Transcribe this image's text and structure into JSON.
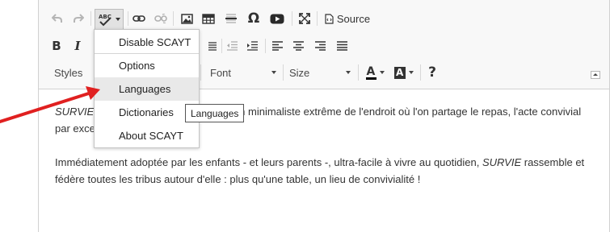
{
  "toolbar": {
    "undo_icon": "undo-icon",
    "redo_icon": "redo-icon",
    "spellcheck_icon": "spellcheck-abc-icon",
    "source_label": "Source",
    "bold_glyph": "B",
    "italic_glyph": "I",
    "omega_glyph": "Ω",
    "help_glyph": "?",
    "text_color_glyph": "A",
    "bg_color_glyph": "A",
    "combos": {
      "styles": "Styles",
      "font": "Font",
      "size": "Size"
    }
  },
  "scayt_menu": {
    "items": [
      {
        "label": "Disable SCAYT"
      },
      {
        "label": "Options"
      },
      {
        "label": "Languages"
      },
      {
        "label": "Dictionaries"
      },
      {
        "label": "About SCAYT"
      }
    ],
    "hovered_index": 2
  },
  "tooltip": {
    "text": "Languages"
  },
  "content": {
    "p1_em": "SURVIE",
    "p1_line1_rest": "n minimaliste extrême de l'endroit où l'on partage le repas, l'acte convivial",
    "p1_line2": "par exce",
    "p2_before": "Immédiatement adoptée par les enfants - et leurs parents -, ultra-facile à vivre au quotidien, ",
    "p2_em": "SURVIE",
    "p2_after": " rassemble et fédère toutes les tribus autour d'elle : plus qu'une table, un lieu de convivialité !"
  },
  "colors": {
    "arrow": "#e02020",
    "toolbar_bg": "#f8f8f8",
    "menu_hover": "#e9e9e9"
  }
}
